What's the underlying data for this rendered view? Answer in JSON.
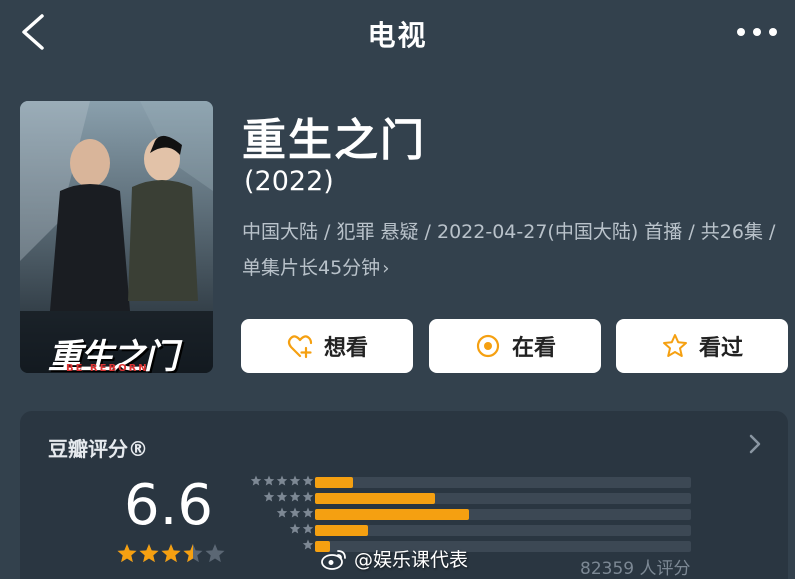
{
  "header": {
    "title": "电视",
    "back_icon": "chevron-left-icon",
    "more_icon": "more-dots-icon"
  },
  "poster": {
    "title_art": "重生之门",
    "subtitle_art": "BE REBORN"
  },
  "show": {
    "title": "重生之门",
    "year": "(2022)",
    "meta": "中国大陆 / 犯罪 悬疑 / 2022-04-27(中国大陆) 首播 / 共26集 / 单集片长45分钟",
    "meta_arrow": "›"
  },
  "actions": [
    {
      "label": "想看",
      "icon": "heart-plus-icon"
    },
    {
      "label": "在看",
      "icon": "target-circle-icon"
    },
    {
      "label": "看过",
      "icon": "star-outline-icon"
    }
  ],
  "rating": {
    "label": "豆瓣评分®",
    "score": "6.6",
    "score_stars": 3.5,
    "count": "82359 人评分",
    "distribution": [
      {
        "stars": 5,
        "fraction": 0.1
      },
      {
        "stars": 4,
        "fraction": 0.32
      },
      {
        "stars": 3,
        "fraction": 0.41
      },
      {
        "stars": 2,
        "fraction": 0.14
      },
      {
        "stars": 1,
        "fraction": 0.04
      }
    ]
  },
  "watermark": {
    "text": "@娱乐课代表",
    "icon": "weibo-icon"
  },
  "colors": {
    "background": "#33414d",
    "card": "#2a3641",
    "accent": "#f5a011",
    "button_icon": "#f5a011"
  }
}
